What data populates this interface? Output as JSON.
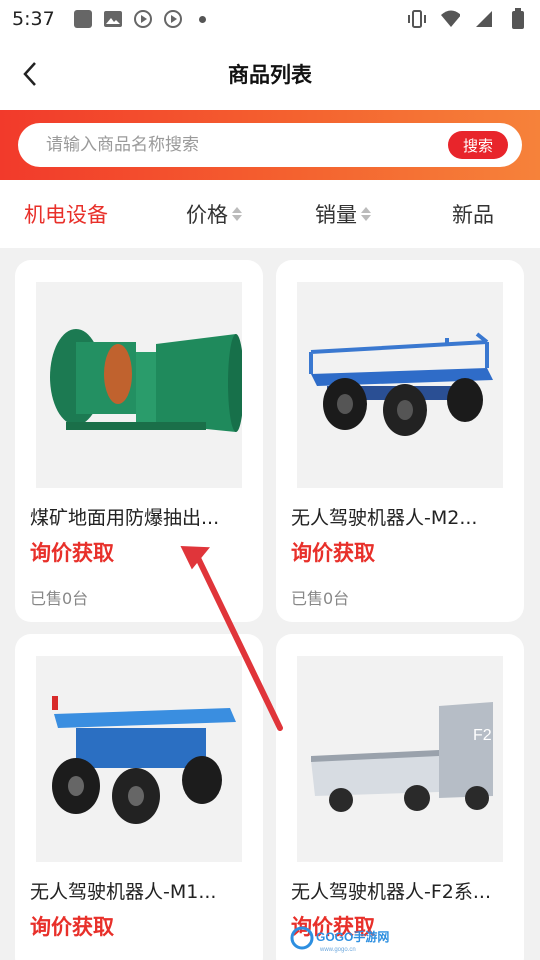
{
  "status_bar": {
    "time": "5:37"
  },
  "header": {
    "title": "商品列表"
  },
  "search": {
    "placeholder": "请输入商品名称搜索",
    "button_label": "搜索"
  },
  "tabs": [
    {
      "label": "机电设备",
      "active": true
    },
    {
      "label": "价格",
      "sortable": true
    },
    {
      "label": "销量",
      "sortable": true
    },
    {
      "label": "新品"
    }
  ],
  "products": [
    {
      "title": "煤矿地面用防爆抽出...",
      "price": "询价获取",
      "sold": "已售0台",
      "image": "green-explosion-proof-fan"
    },
    {
      "title": "无人驾驶机器人-M2...",
      "price": "询价获取",
      "sold": "已售0台",
      "image": "blue-unmanned-robot-cart"
    },
    {
      "title": "无人驾驶机器人-M1...",
      "price": "询价获取",
      "sold": "",
      "image": "blue-unmanned-robot-vehicle"
    },
    {
      "title": "无人驾驶机器人-F2系...",
      "price": "询价获取",
      "sold": "",
      "image": "gray-f2-robot-truck"
    }
  ],
  "watermark": {
    "text": "GOGO手游网",
    "subtext": "www.gogo.cn"
  },
  "colors": {
    "accent": "#e8302a",
    "gradient_start": "#f23a2b",
    "gradient_end": "#f6823a"
  }
}
